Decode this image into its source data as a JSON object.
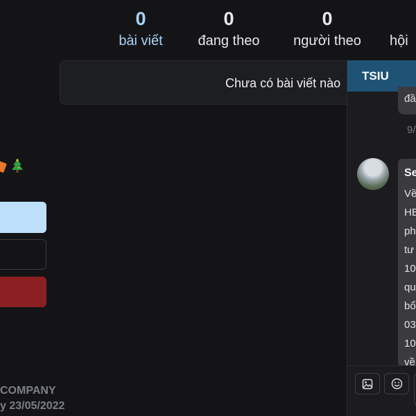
{
  "stats": {
    "posts": {
      "count": "0",
      "label": "bài viết"
    },
    "following": {
      "count": "0",
      "label": "đang theo"
    },
    "followers": {
      "count": "0",
      "label": "người theo"
    },
    "groups": {
      "label": "hội"
    }
  },
  "feed": {
    "empty_text": "Chưa có bài viết nào"
  },
  "sidebar": {
    "footer_company": "COMPANY",
    "footer_date": "y 23/05/2022"
  },
  "chat": {
    "title": "TSIU",
    "prev_bubble_text": "đầ",
    "timestamp": "9/",
    "message": {
      "sender": "Se",
      "lines": [
        "Về",
        "HE",
        "ph",
        "tư",
        "10",
        "qu",
        "bổ",
        "03",
        "10",
        "về"
      ]
    }
  },
  "colors": {
    "accent": "#a8d4f8",
    "chat_header": "#1f5375",
    "danger": "#8c1f22"
  }
}
